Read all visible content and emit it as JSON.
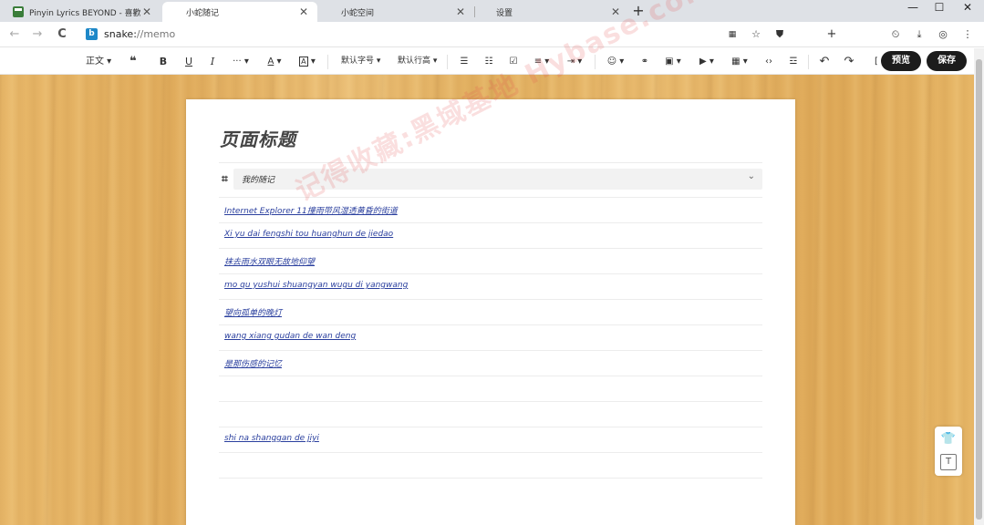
{
  "browser": {
    "tabs": [
      {
        "title": "Pinyin Lyrics BEYOND - 喜歡...",
        "active": false
      },
      {
        "title": "小蛇随记",
        "active": true
      },
      {
        "title": "小蛇空间",
        "active": false
      },
      {
        "title": "设置",
        "active": false
      }
    ],
    "new_tab": "+",
    "window": {
      "minimize": "—",
      "maximize": "☐",
      "close": "✕"
    },
    "url_scheme": "snake:",
    "url_path": "//memo"
  },
  "toolbar": {
    "paragraph": "正文",
    "quote": "❝",
    "bold": "B",
    "underline": "U",
    "italic": "I",
    "more": "···",
    "font_color": "A",
    "bg_color": "A",
    "font_size": "默认字号",
    "line_height": "默认行高",
    "preview": "预览",
    "save": "保存"
  },
  "page": {
    "title": "页面标题",
    "category": "我的随记",
    "lines": [
      "Internet Explorer 11撞雨带风湿透黄昏的街道",
      "Xi yu dai fengshi tou huanghun de jiedao",
      "抹去雨水双眼无故地仰望",
      "mo qu yushui shuangyan wugu di yangwang",
      "望向孤单的晚灯",
      "wang xiang gudan de wan deng",
      "是那伤感的记忆",
      "",
      "",
      "shi na shanggan de jiyi"
    ]
  },
  "watermark": "记得收藏:黑域基地 Hybase.com"
}
